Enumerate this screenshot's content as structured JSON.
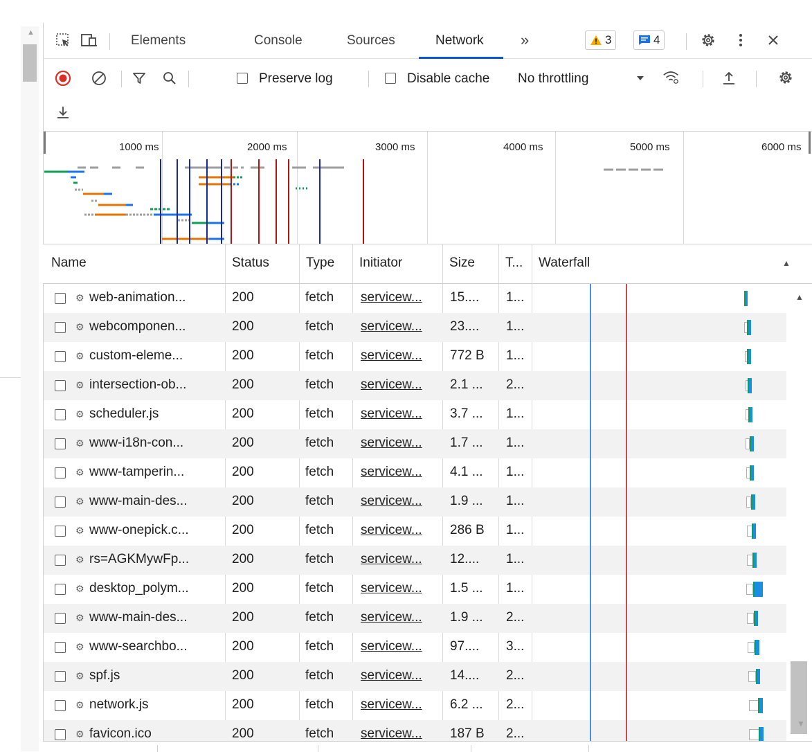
{
  "devtools": {
    "tabs": [
      {
        "label": "Elements"
      },
      {
        "label": "Console"
      },
      {
        "label": "Sources"
      },
      {
        "label": "Network"
      }
    ],
    "more_tabs": "»",
    "warnings_count": "3",
    "messages_count": "4",
    "colors": {
      "accent": "#0b57d0",
      "record": "#d93025",
      "warning": "#f9ab00",
      "info": "#1a73e8"
    }
  },
  "toolbar": {
    "preserve_log": "Preserve log",
    "disable_cache": "Disable cache",
    "throttling": "No throttling"
  },
  "overview": {
    "ticks": [
      "1000 ms",
      "2000 ms",
      "3000 ms",
      "4000 ms",
      "5000 ms",
      "6000 ms"
    ]
  },
  "table": {
    "headers": {
      "name": "Name",
      "status": "Status",
      "type": "Type",
      "initiator": "Initiator",
      "size": "Size",
      "time": "T...",
      "waterfall": "Waterfall"
    },
    "rows": [
      {
        "name": "web-animation...",
        "status": "200",
        "type": "fetch",
        "initiator": "servicew...",
        "size": "15....",
        "time": "1..."
      },
      {
        "name": "webcomponen...",
        "status": "200",
        "type": "fetch",
        "initiator": "servicew...",
        "size": "23....",
        "time": "1..."
      },
      {
        "name": "custom-eleme...",
        "status": "200",
        "type": "fetch",
        "initiator": "servicew...",
        "size": "772 B",
        "time": "1..."
      },
      {
        "name": "intersection-ob...",
        "status": "200",
        "type": "fetch",
        "initiator": "servicew...",
        "size": "2.1 ...",
        "time": "2..."
      },
      {
        "name": "scheduler.js",
        "status": "200",
        "type": "fetch",
        "initiator": "servicew...",
        "size": "3.7 ...",
        "time": "1..."
      },
      {
        "name": "www-i18n-con...",
        "status": "200",
        "type": "fetch",
        "initiator": "servicew...",
        "size": "1.7 ...",
        "time": "1..."
      },
      {
        "name": "www-tamperin...",
        "status": "200",
        "type": "fetch",
        "initiator": "servicew...",
        "size": "4.1 ...",
        "time": "1..."
      },
      {
        "name": "www-main-des...",
        "status": "200",
        "type": "fetch",
        "initiator": "servicew...",
        "size": "1.9 ...",
        "time": "1..."
      },
      {
        "name": "www-onepick.c...",
        "status": "200",
        "type": "fetch",
        "initiator": "servicew...",
        "size": "286 B",
        "time": "1..."
      },
      {
        "name": "rs=AGKMywFp...",
        "status": "200",
        "type": "fetch",
        "initiator": "servicew...",
        "size": "12....",
        "time": "1..."
      },
      {
        "name": "desktop_polym...",
        "status": "200",
        "type": "fetch",
        "initiator": "servicew...",
        "size": "1.5 ...",
        "time": "1..."
      },
      {
        "name": "www-main-des...",
        "status": "200",
        "type": "fetch",
        "initiator": "servicew...",
        "size": "1.9 ...",
        "time": "2..."
      },
      {
        "name": "www-searchbo...",
        "status": "200",
        "type": "fetch",
        "initiator": "servicew...",
        "size": "97....",
        "time": "3..."
      },
      {
        "name": "spf.js",
        "status": "200",
        "type": "fetch",
        "initiator": "servicew...",
        "size": "14....",
        "time": "2..."
      },
      {
        "name": "network.js",
        "status": "200",
        "type": "fetch",
        "initiator": "servicew...",
        "size": "6.2 ...",
        "time": "2..."
      },
      {
        "name": "favicon.ico",
        "status": "200",
        "type": "fetch",
        "initiator": "servicew...",
        "size": "187 B",
        "time": "2..."
      }
    ]
  }
}
